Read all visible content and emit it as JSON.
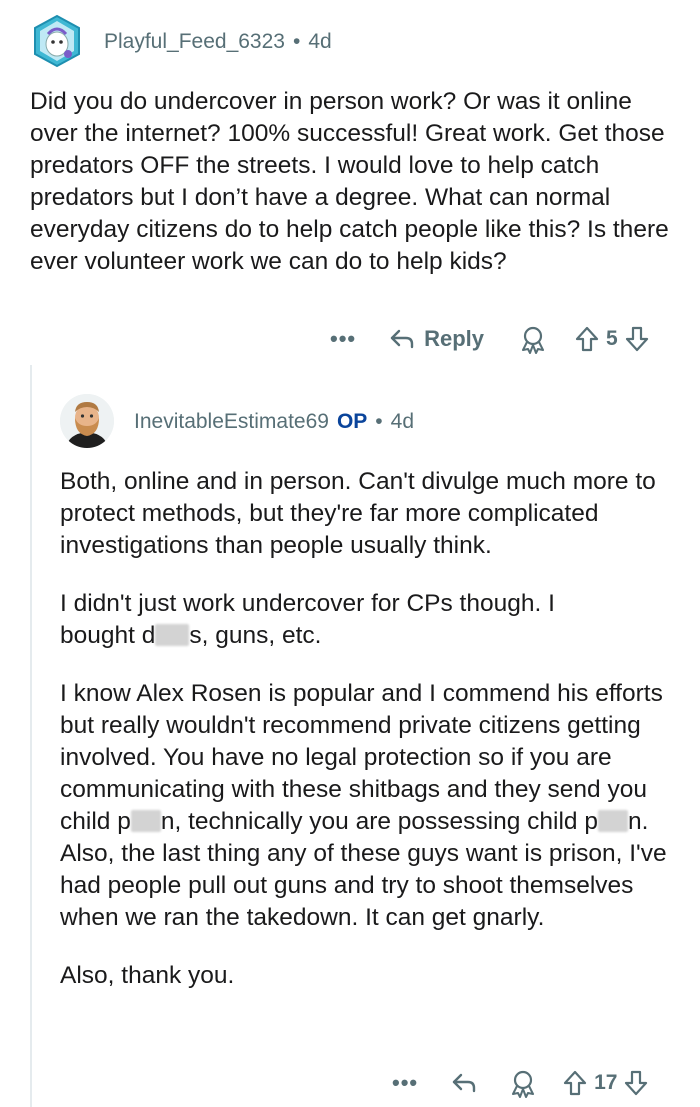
{
  "comments": [
    {
      "username": "Playful_Feed_6323",
      "separator": "•",
      "age": "4d",
      "avatar_icon": "ghost-snoo-avatar",
      "body": [
        "Did you do undercover in person work? Or was it online over the internet?  100% successful! Great work. Get those predators OFF the streets. I would love to help catch predators but I don’t have a degree. What can normal everyday citizens do to help catch people like this?  Is there ever volunteer work we can do to help kids?"
      ],
      "actions": {
        "more": "•••",
        "reply_label": "Reply",
        "vote_count": "5"
      }
    },
    {
      "username": "InevitableEstimate69",
      "op_badge": "OP",
      "separator": "•",
      "age": "4d",
      "avatar_icon": "bearded-man-avatar",
      "body": [
        "Both, online and in person. Can't divulge much more to protect methods, but they're far more complicated investigations than people usually think.",
        "I didn't just work undercover for CPs though. I",
        "bought d",
        "s, guns, etc.",
        "I know Alex Rosen is popular and I commend his efforts but really wouldn't recommend private citizens getting involved. You have no legal protection so if you are communicating with these shitbags and they send you child p",
        "n, technically you are possessing child p",
        "n. Also, the last thing any of these guys want is prison, I've had people pull out guns and try to shoot themselves when we ran the takedown. It can get gnarly.",
        "Also, thank you."
      ],
      "actions": {
        "more": "•••",
        "vote_count": "17"
      }
    }
  ],
  "colors": {
    "meta_text": "#576f76",
    "op_badge": "#0a449b",
    "body_text": "#1a1a1b",
    "thread_line": "#e5ebee",
    "redaction": "#d3d3d3"
  }
}
